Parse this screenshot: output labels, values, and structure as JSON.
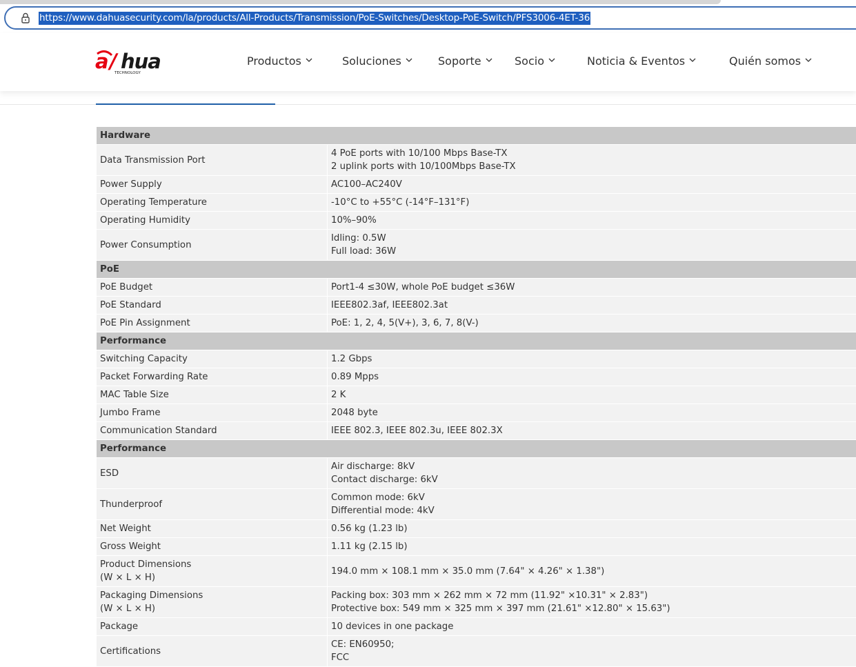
{
  "browser": {
    "url": "https://www.dahuasecurity.com/la/products/All-Products/Transmission/PoE-Switches/Desktop-PoE-Switch/PFS3006-4ET-36"
  },
  "site": {
    "logo_text": "alhua",
    "logo_sub": "TECHNOLOGY",
    "brand_color": "#e60012",
    "nav": [
      {
        "label": "Productos"
      },
      {
        "label": "Soluciones"
      },
      {
        "label": "Soporte"
      },
      {
        "label": "Socio"
      },
      {
        "label": "Noticia & Eventos"
      },
      {
        "label": "Quién somos"
      }
    ]
  },
  "specs": {
    "sections": [
      {
        "title": "Hardware",
        "rows": [
          {
            "label": [
              "Data Transmission Port"
            ],
            "value": [
              "4 PoE ports with 10/100 Mbps Base-TX",
              "2 uplink ports with 10/100Mbps Base-TX"
            ]
          },
          {
            "label": [
              "Power Supply"
            ],
            "value": [
              "AC100–AC240V"
            ]
          },
          {
            "label": [
              "Operating Temperature"
            ],
            "value": [
              "-10°C to +55°C (-14°F–131°F)"
            ]
          },
          {
            "label": [
              "Operating Humidity"
            ],
            "value": [
              "10%–90%"
            ]
          },
          {
            "label": [
              "Power Consumption"
            ],
            "value": [
              "Idling: 0.5W",
              "Full load: 36W"
            ]
          }
        ]
      },
      {
        "title": "PoE",
        "rows": [
          {
            "label": [
              "PoE Budget"
            ],
            "value": [
              "Port1-4 ≤30W, whole PoE budget ≤36W"
            ]
          },
          {
            "label": [
              "PoE Standard"
            ],
            "value": [
              "IEEE802.3af, IEEE802.3at"
            ]
          },
          {
            "label": [
              "PoE Pin Assignment"
            ],
            "value": [
              "PoE: 1, 2, 4, 5(V+), 3, 6, 7, 8(V-)"
            ]
          }
        ]
      },
      {
        "title": "Performance",
        "rows": [
          {
            "label": [
              "Switching Capacity"
            ],
            "value": [
              "1.2 Gbps"
            ]
          },
          {
            "label": [
              "Packet Forwarding Rate"
            ],
            "value": [
              "0.89 Mpps"
            ]
          },
          {
            "label": [
              "MAC Table Size"
            ],
            "value": [
              "2 K"
            ]
          },
          {
            "label": [
              "Jumbo Frame"
            ],
            "value": [
              "2048 byte"
            ]
          },
          {
            "label": [
              "Communication Standard"
            ],
            "value": [
              "IEEE 802.3, IEEE 802.3u, IEEE 802.3X"
            ]
          }
        ]
      },
      {
        "title": "Performance",
        "rows": [
          {
            "label": [
              "ESD"
            ],
            "value": [
              "Air discharge: 8kV",
              "Contact discharge: 6kV"
            ]
          },
          {
            "label": [
              "Thunderproof"
            ],
            "value": [
              "Common mode: 6kV",
              "Differential mode: 4kV"
            ]
          },
          {
            "label": [
              "Net Weight"
            ],
            "value": [
              "0.56 kg (1.23 lb)"
            ]
          },
          {
            "label": [
              "Gross Weight"
            ],
            "value": [
              "1.11 kg (2.15 lb)"
            ]
          },
          {
            "label": [
              "Product Dimensions",
              "(W × L × H)"
            ],
            "value": [
              "194.0 mm × 108.1 mm × 35.0 mm (7.64\" × 4.26\" × 1.38\")"
            ]
          },
          {
            "label": [
              "Packaging Dimensions",
              "(W × L × H)"
            ],
            "value": [
              "Packing box: 303 mm × 262 mm × 72 mm (11.92\" ×10.31\" × 2.83\")",
              "Protective box: 549 mm × 325 mm × 397 mm (21.61\" ×12.80\" × 15.63\")"
            ]
          },
          {
            "label": [
              "Package"
            ],
            "value": [
              "10 devices in one package"
            ]
          },
          {
            "label": [
              "Certifications"
            ],
            "value": [
              "CE: EN60950;",
              "FCC"
            ]
          }
        ]
      }
    ]
  }
}
